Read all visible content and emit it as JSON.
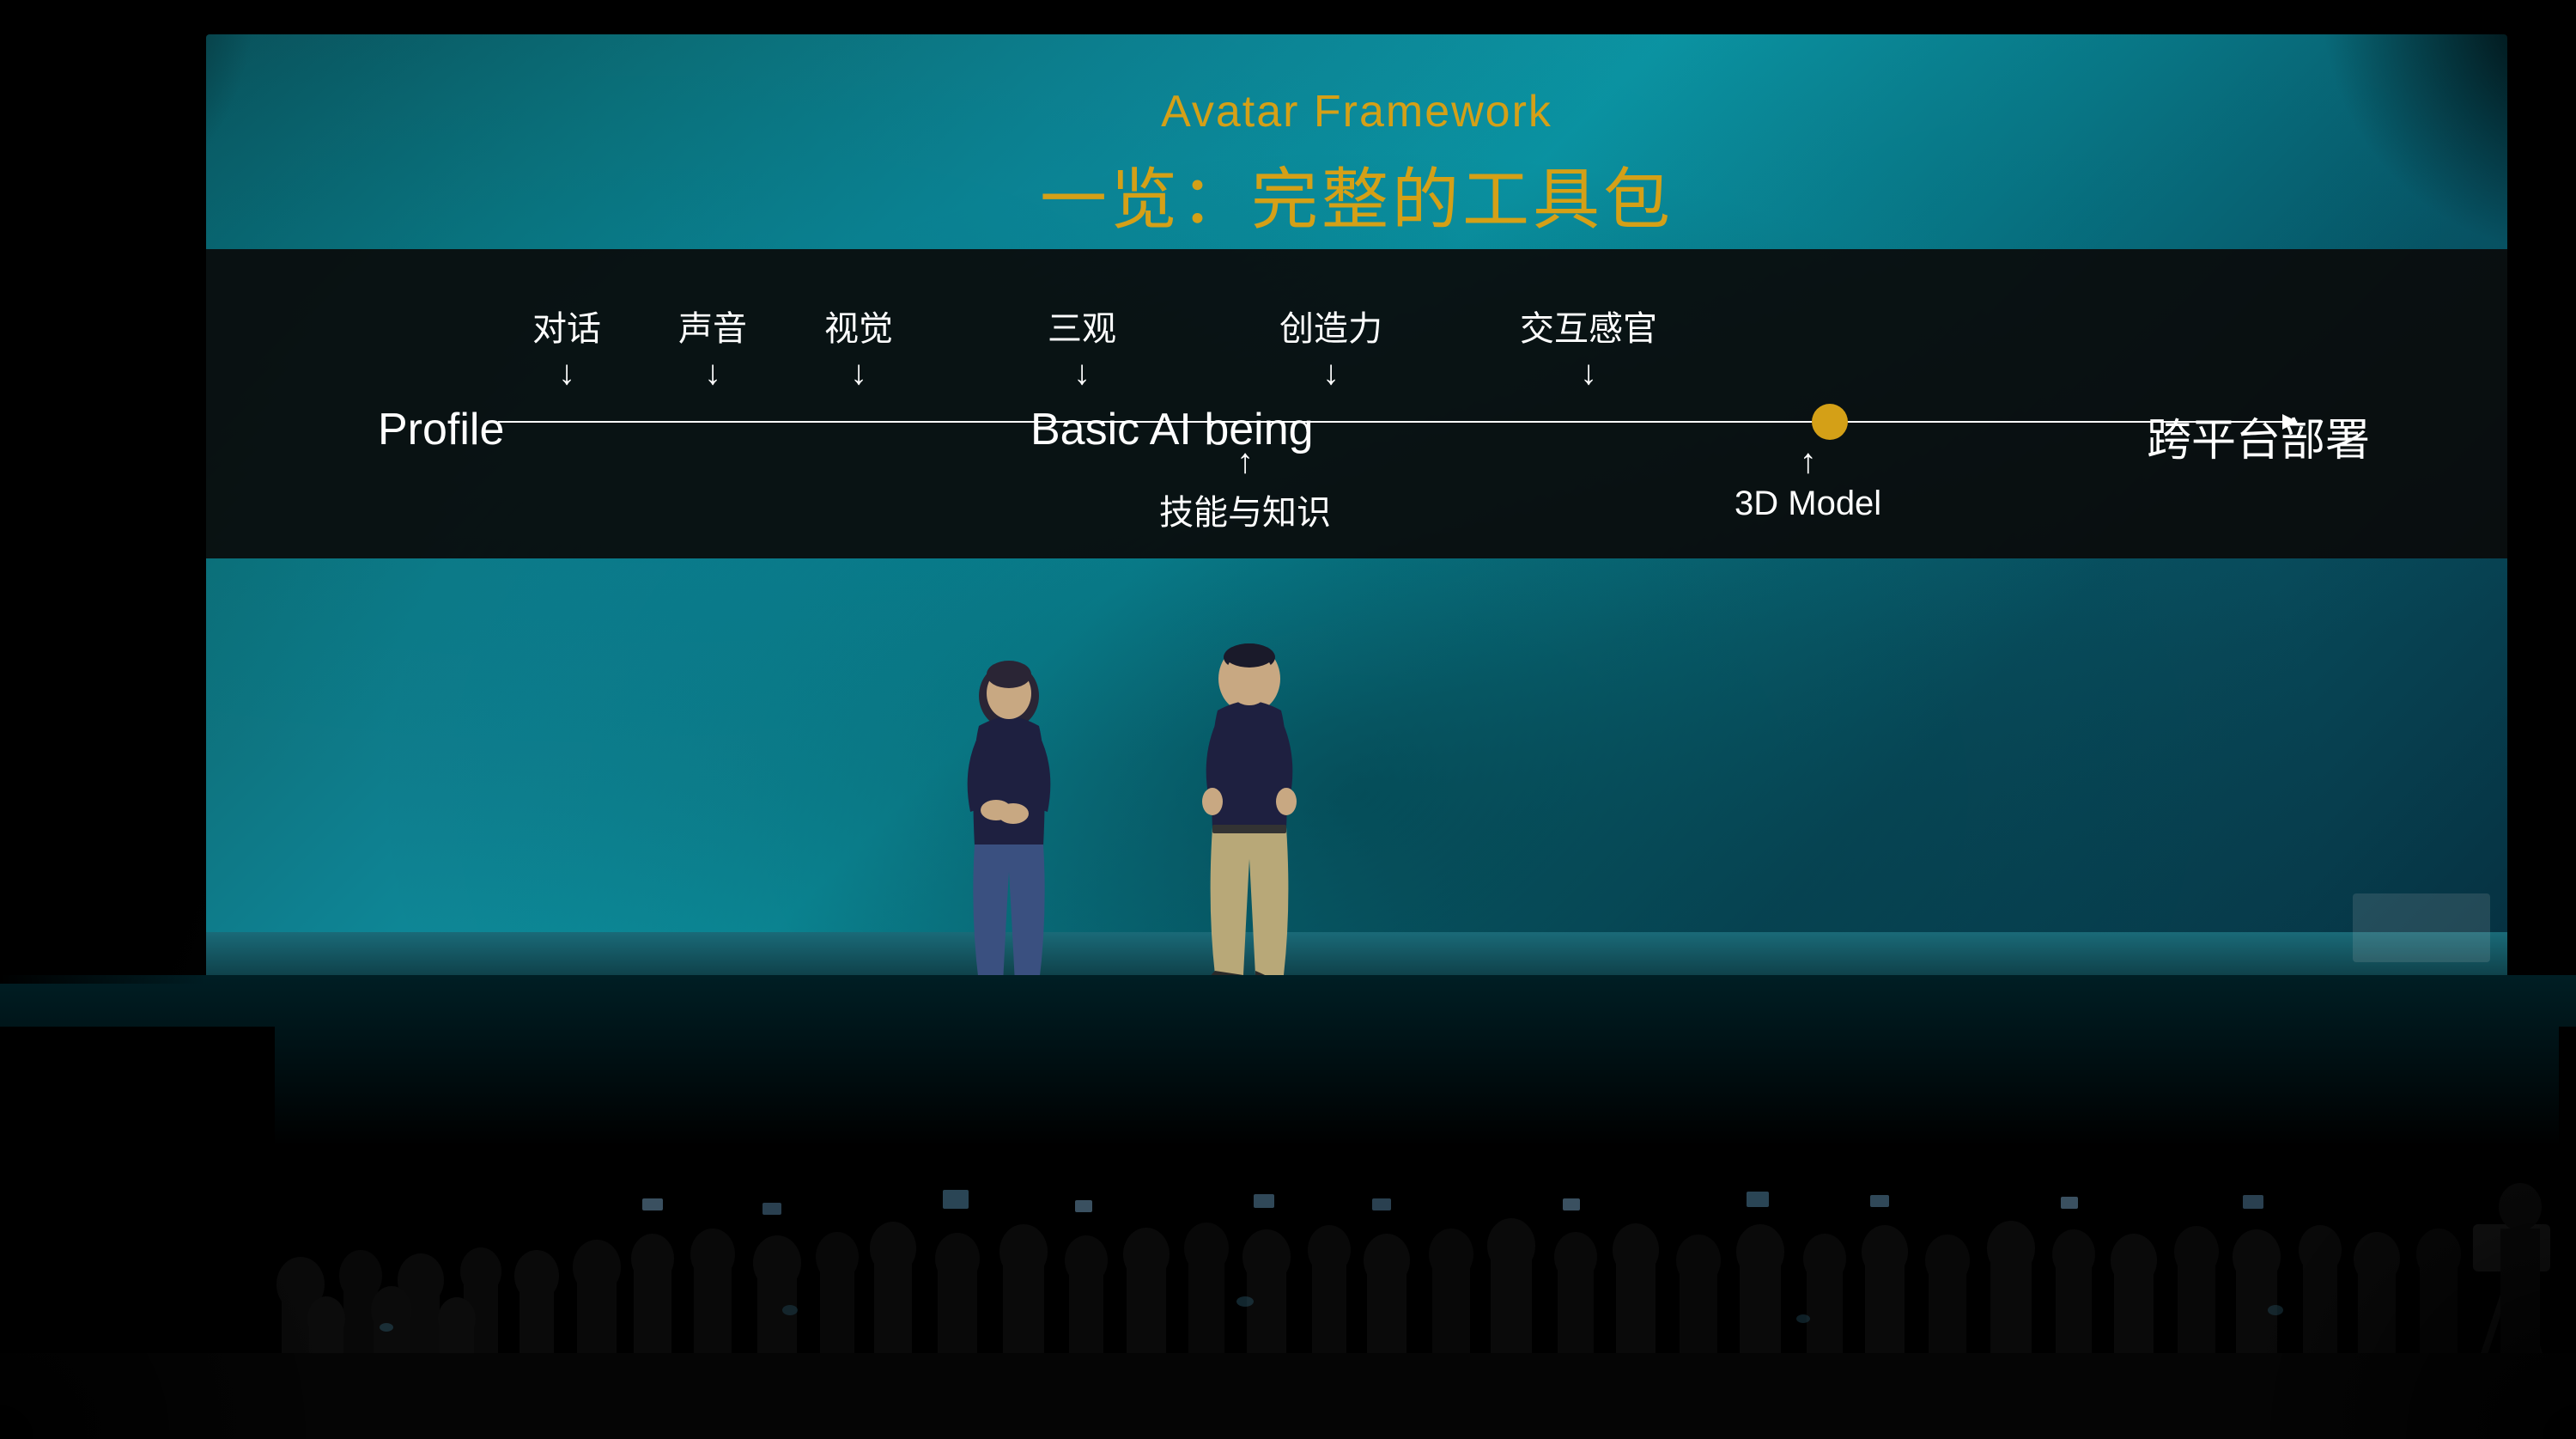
{
  "screen": {
    "title_en": "Avatar Framework",
    "title_zh": "一览：完整的工具包"
  },
  "diagram": {
    "label_profile": "Profile",
    "label_basic_ai": "Basic AI being",
    "label_cross_platform": "跨平台部署",
    "above_labels": [
      {
        "text": "对话",
        "position": 280
      },
      {
        "text": "声音",
        "position": 430
      },
      {
        "text": "视觉",
        "position": 590
      },
      {
        "text": "三观",
        "position": 850
      },
      {
        "text": "创造力",
        "position": 1130
      },
      {
        "text": "交互感官",
        "position": 1420
      }
    ],
    "below_labels": [
      {
        "text": "技能与知识",
        "position": 1050
      },
      {
        "text": "3D Model",
        "position": 1670
      }
    ]
  },
  "colors": {
    "title_gold": "#d4a017",
    "screen_teal": "#0d8090",
    "line_white": "#ffffff",
    "circle_gold": "#d4a017",
    "text_white": "#ffffff",
    "background": "#000000"
  }
}
